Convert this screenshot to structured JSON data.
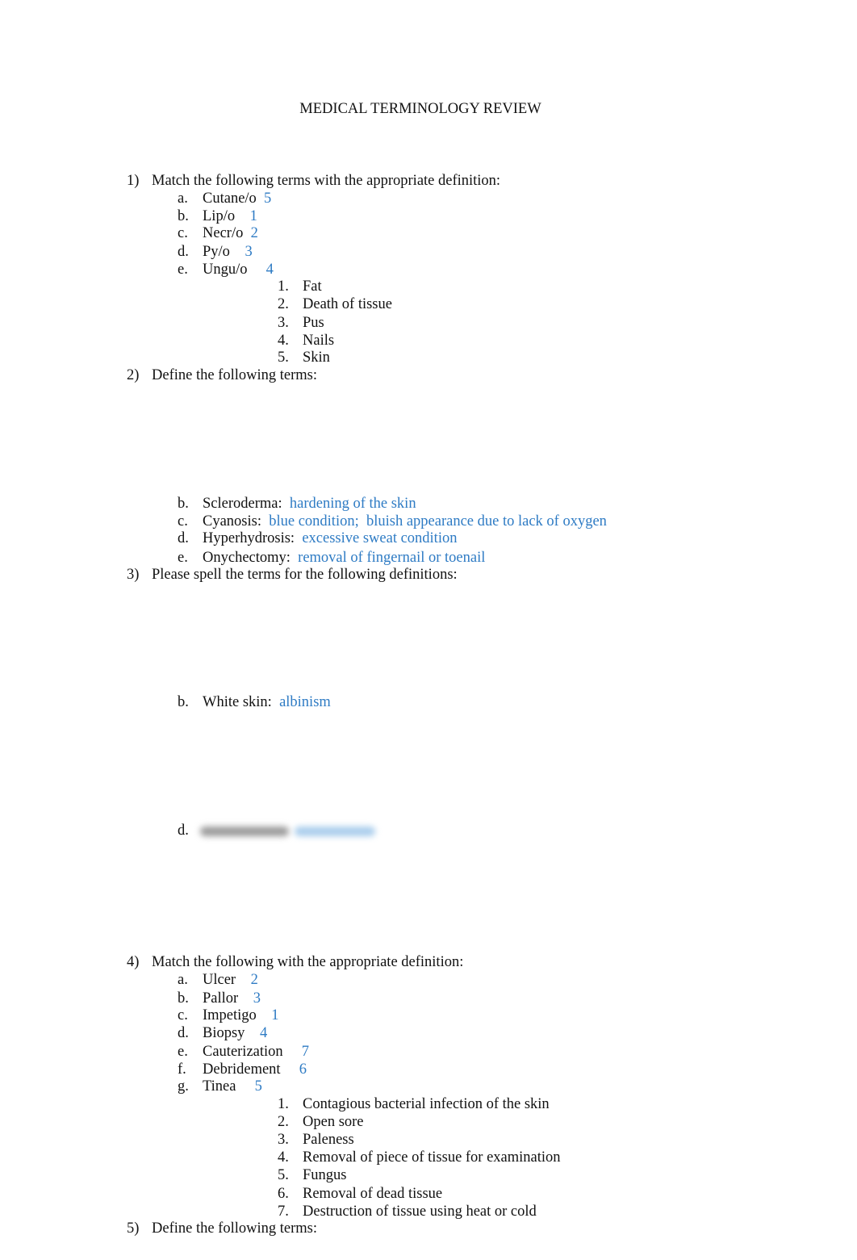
{
  "document": {
    "title": "MEDICAL TERMINOLOGY REVIEW"
  },
  "questions": [
    {
      "number": "1)",
      "prompt": "Match the following terms with the appropriate definition:",
      "items": [
        {
          "letter": "a.",
          "term": "Cutane/o",
          "answer": "5"
        },
        {
          "letter": "b.",
          "term": "Lip/o",
          "answer": "1"
        },
        {
          "letter": "c.",
          "term": "Necr/o",
          "answer": "2"
        },
        {
          "letter": "d.",
          "term": "Py/o",
          "answer": "3"
        },
        {
          "letter": "e.",
          "term": "Ungu/o",
          "answer": "4"
        }
      ],
      "definitions": [
        {
          "number": "1.",
          "text": "Fat"
        },
        {
          "number": "2.",
          "text": "Death of tissue"
        },
        {
          "number": "3.",
          "text": "Pus"
        },
        {
          "number": "4.",
          "text": "Nails"
        },
        {
          "number": "5.",
          "text": "Skin"
        }
      ]
    },
    {
      "number": "2)",
      "prompt": "Define the following terms:",
      "items": [
        {
          "letter": "b.",
          "term": "Scleroderma:",
          "answer": "hardening of the skin"
        },
        {
          "letter": "c.",
          "term": "Cyanosis:",
          "answer": "blue condition;  bluish appearance due to lack of oxygen"
        },
        {
          "letter": "d.",
          "term": "Hyperhydrosis:",
          "answer": "excessive sweat condition"
        },
        {
          "letter": "e.",
          "term": "Onychectomy:",
          "answer": "removal of fingernail or toenail"
        }
      ]
    },
    {
      "number": "3)",
      "prompt": "Please spell the terms for the following definitions:",
      "items": [
        {
          "letter": "b.",
          "term": "White skin:",
          "answer": "albinism"
        },
        {
          "letter": "d.",
          "term": "",
          "answer": "",
          "redacted": true
        }
      ]
    },
    {
      "number": "4)",
      "prompt": "Match the following with the appropriate definition:",
      "items": [
        {
          "letter": "a.",
          "term": "Ulcer",
          "answer": "2"
        },
        {
          "letter": "b.",
          "term": "Pallor",
          "answer": "3"
        },
        {
          "letter": "c.",
          "term": "Impetigo",
          "answer": "1"
        },
        {
          "letter": "d.",
          "term": "Biopsy",
          "answer": "4"
        },
        {
          "letter": "e.",
          "term": "Cauterization",
          "answer": "7"
        },
        {
          "letter": "f.",
          "term": "Debridement",
          "answer": "6"
        },
        {
          "letter": "g.",
          "term": "Tinea",
          "answer": "5"
        }
      ],
      "definitions": [
        {
          "number": "1.",
          "text": "Contagious bacterial infection of the skin"
        },
        {
          "number": "2.",
          "text": "Open sore"
        },
        {
          "number": "3.",
          "text": "Paleness"
        },
        {
          "number": "4.",
          "text": "Removal of piece of tissue for examination"
        },
        {
          "number": "5.",
          "text": "Fungus"
        },
        {
          "number": "6.",
          "text": "Removal of dead tissue"
        },
        {
          "number": "7.",
          "text": "Destruction of tissue using heat or cold"
        }
      ]
    },
    {
      "number": "5)",
      "prompt": "Define the following terms:"
    }
  ],
  "colors": {
    "answer": "#2E7BC4",
    "text": "#111111"
  }
}
